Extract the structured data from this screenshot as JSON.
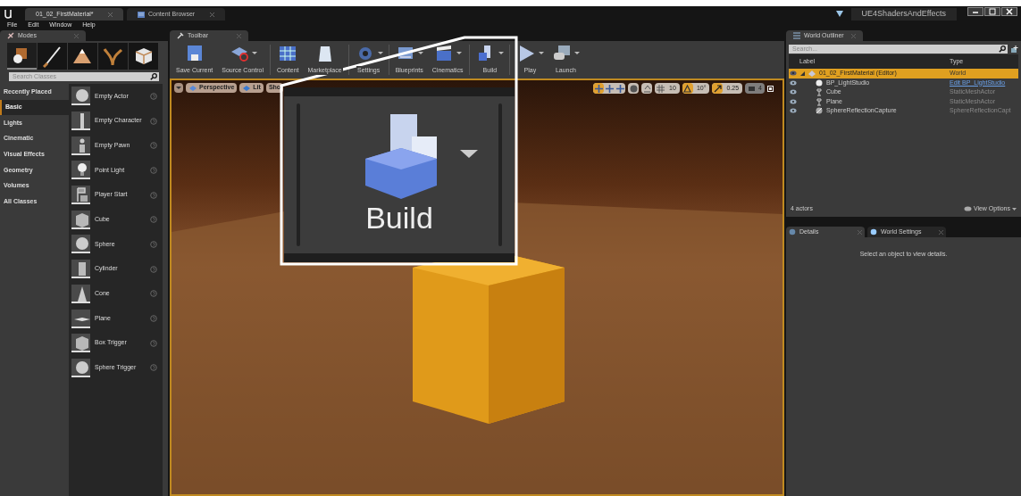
{
  "title_bar": {
    "tabs": [
      {
        "label": "01_02_FirstMaterial*",
        "kind": "level",
        "selected": true
      },
      {
        "label": "Content Browser",
        "kind": "browser",
        "selected": false
      }
    ],
    "project": "UE4ShadersAndEffects"
  },
  "menu": [
    "File",
    "Edit",
    "Window",
    "Help"
  ],
  "modes_panel": {
    "tab": "Modes",
    "modes": [
      {
        "kind": "place",
        "selected": true
      },
      {
        "kind": "paint",
        "selected": false
      },
      {
        "kind": "landscape",
        "selected": false
      },
      {
        "kind": "foliage",
        "selected": false
      },
      {
        "kind": "geometry",
        "selected": false
      }
    ],
    "search": {
      "placeholder": "Search Classes"
    },
    "categories": [
      {
        "label": "Recently Placed",
        "selected": false
      },
      {
        "label": "Basic",
        "selected": true
      },
      {
        "label": "Lights",
        "selected": false
      },
      {
        "label": "Cinematic",
        "selected": false
      },
      {
        "label": "Visual Effects",
        "selected": false
      },
      {
        "label": "Geometry",
        "selected": false
      },
      {
        "label": "Volumes",
        "selected": false
      },
      {
        "label": "All Classes",
        "selected": false
      }
    ],
    "items": [
      {
        "label": "Empty Actor",
        "kind": "sphere"
      },
      {
        "label": "Empty Character",
        "kind": "character"
      },
      {
        "label": "Empty Pawn",
        "kind": "pawn"
      },
      {
        "label": "Point Light",
        "kind": "bulb"
      },
      {
        "label": "Player Start",
        "kind": "flag"
      },
      {
        "label": "Cube",
        "kind": "cube"
      },
      {
        "label": "Sphere",
        "kind": "sphere"
      },
      {
        "label": "Cylinder",
        "kind": "cylinder"
      },
      {
        "label": "Cone",
        "kind": "cone"
      },
      {
        "label": "Plane",
        "kind": "plane"
      },
      {
        "label": "Box Trigger",
        "kind": "cube"
      },
      {
        "label": "Sphere Trigger",
        "kind": "sphere"
      }
    ]
  },
  "toolbar": {
    "tab": "Toolbar",
    "buttons": [
      {
        "label": "Save Current",
        "kind": "disk",
        "dropdown": false
      },
      {
        "label": "Source Control",
        "kind": "source",
        "dropdown": true
      },
      {
        "label": "Content",
        "kind": "grid",
        "dropdown": false
      },
      {
        "label": "Marketplace",
        "kind": "bag",
        "dropdown": false
      },
      {
        "label": "Settings",
        "kind": "gear",
        "dropdown": true
      },
      {
        "label": "Blueprints",
        "kind": "blueprint",
        "dropdown": true
      },
      {
        "label": "Cinematics",
        "kind": "clapper",
        "dropdown": true
      },
      {
        "label": "Build",
        "kind": "build",
        "dropdown": true
      },
      {
        "label": "Play",
        "kind": "play",
        "dropdown": true
      },
      {
        "label": "Launch",
        "kind": "launch",
        "dropdown": true
      }
    ]
  },
  "viewport": {
    "view": "Perspective",
    "mode": "Lit",
    "show": "Sho",
    "grid_snap": "10",
    "rotation_snap": "10°",
    "scale_snap": "0.25",
    "camera_speed": "4"
  },
  "callout": {
    "label": "Build"
  },
  "world_outliner": {
    "tab": "World Outliner",
    "search": {
      "placeholder": "Search..."
    },
    "columns": [
      "Label",
      "Type"
    ],
    "rows": [
      {
        "label": "01_02_FirstMaterial (Editor)",
        "type": "World",
        "link": false,
        "selected": true,
        "expanded": true,
        "children": [
          {
            "label": "BP_LightStudio",
            "type": "Edit BP_LightStudio",
            "link": true,
            "selected": false
          },
          {
            "label": "Cube",
            "type": "StaticMeshActor",
            "link": false,
            "selected": false
          },
          {
            "label": "Plane",
            "type": "StaticMeshActor",
            "link": false,
            "selected": false
          },
          {
            "label": "SphereReflectionCapture",
            "type": "SphereReflectionCapt",
            "link": false,
            "selected": false
          }
        ]
      }
    ],
    "count": "4 actors",
    "view_options": "View Options"
  },
  "details": {
    "tabs": [
      {
        "label": "Details",
        "selected": true
      },
      {
        "label": "World Settings",
        "selected": false
      }
    ],
    "message": "Select an object to view details."
  }
}
